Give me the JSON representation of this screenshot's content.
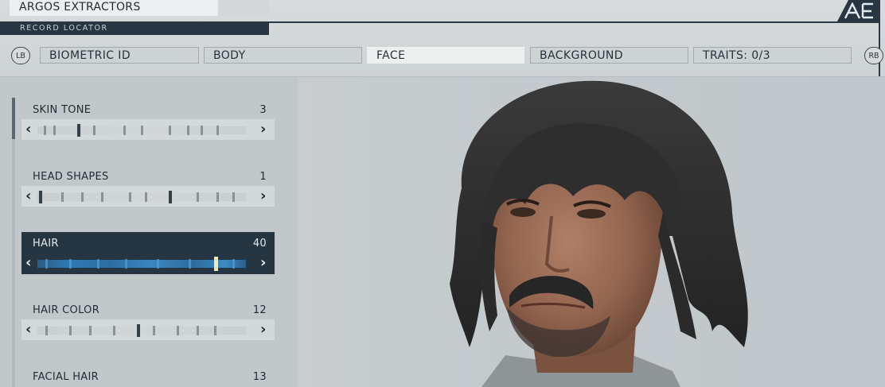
{
  "header": {
    "title": "ARGOS EXTRACTORS",
    "subtitle": "RECORD LOCATOR",
    "logo": "AE"
  },
  "tabs": {
    "left_bumper": "LB",
    "right_bumper": "RB",
    "items": [
      {
        "label": "BIOMETRIC ID",
        "active": false
      },
      {
        "label": "BODY",
        "active": false
      },
      {
        "label": "FACE",
        "active": true
      },
      {
        "label": "BACKGROUND",
        "active": false
      },
      {
        "label": "TRAITS: 0/3",
        "active": false
      }
    ]
  },
  "sliders": [
    {
      "label": "SKIN TONE",
      "value": "3",
      "selected": false
    },
    {
      "label": "HEAD SHAPES",
      "value": "1",
      "selected": false
    },
    {
      "label": "HAIR",
      "value": "40",
      "selected": true
    },
    {
      "label": "HAIR COLOR",
      "value": "12",
      "selected": false
    },
    {
      "label": "FACIAL HAIR",
      "value": "13",
      "selected": false
    }
  ],
  "icons": {
    "prev": "‹",
    "next": "›"
  },
  "colors": {
    "panel_dark": "#253542",
    "highlight": "#f3e9b6"
  }
}
